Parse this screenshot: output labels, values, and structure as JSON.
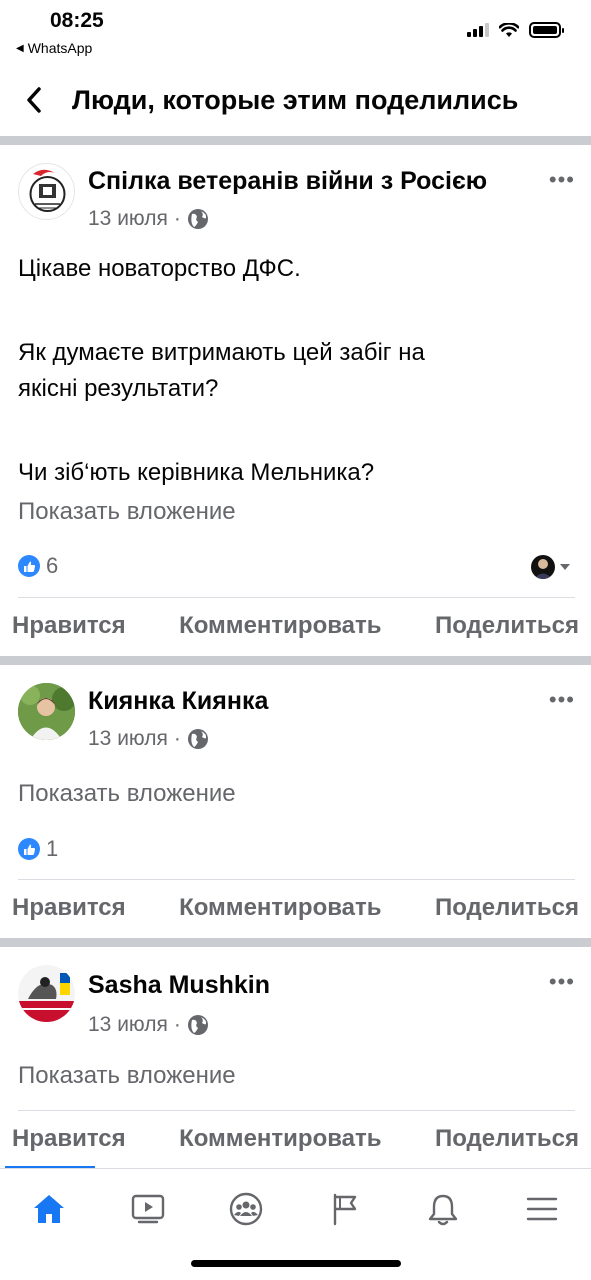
{
  "status_bar": {
    "time": "08:25",
    "back_app": "WhatsApp"
  },
  "header": {
    "title": "Люди, которые этим поделились"
  },
  "actions": {
    "like": "Нравится",
    "comment": "Комментировать",
    "share": "Поделиться"
  },
  "posts": [
    {
      "author": "Спілка ветеранів війни з Росією",
      "date": "13 июля",
      "separator": "·",
      "text_lines": [
        "Цікаве новаторство ДФС.",
        "Як думаєте витримають цей забіг на",
        "якісні результати?",
        "Чи зіб‘ють керівника Мельника?"
      ],
      "attachment_label": "Показать вложение",
      "like_count": "6"
    },
    {
      "author": "Киянка Киянка",
      "date": "13 июля",
      "separator": "·",
      "attachment_label": "Показать вложение",
      "like_count": "1"
    },
    {
      "author": "Sasha Mushkin",
      "date": "13 июля",
      "separator": "·",
      "attachment_label": "Показать вложение"
    }
  ],
  "more_label": "•••",
  "colors": {
    "accent": "#1877f2",
    "like_blue": "#2d88ff",
    "secondary_text": "#65676b",
    "divider": "#c9ccd1"
  },
  "bottom_nav": {
    "items": [
      "home-icon",
      "video-icon",
      "groups-icon",
      "flag-icon",
      "bell-icon",
      "menu-icon"
    ],
    "active": "home-icon"
  }
}
